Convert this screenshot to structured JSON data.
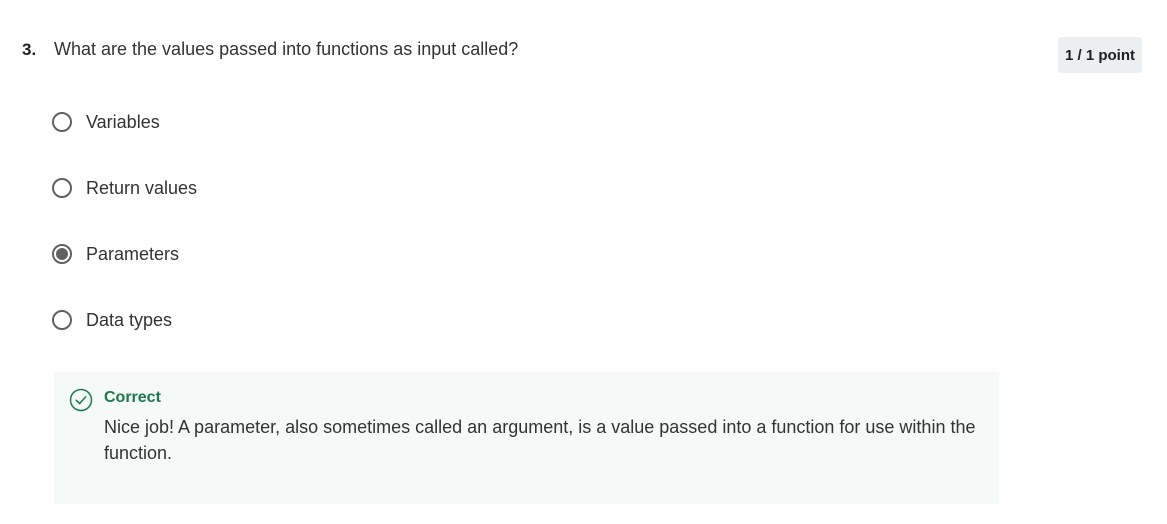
{
  "question": {
    "number": "3.",
    "text": "What are the values passed into functions as input called?",
    "points": "1 / 1 point"
  },
  "options": [
    {
      "label": "Variables",
      "selected": false
    },
    {
      "label": "Return values",
      "selected": false
    },
    {
      "label": "Parameters",
      "selected": true
    },
    {
      "label": "Data types",
      "selected": false
    }
  ],
  "feedback": {
    "status": "Correct",
    "message": "Nice job! A parameter, also sometimes called an argument, is a value passed into a function for use within the function.",
    "icon": "check-circle-icon",
    "accent_color": "#1a7a4c",
    "background_color": "#f5f9f7"
  },
  "colors": {
    "radio_border": "#616161",
    "points_badge_bg": "#eceff1"
  }
}
